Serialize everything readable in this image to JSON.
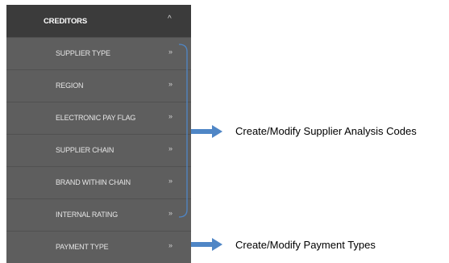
{
  "menu": {
    "header": {
      "label": "CREDITORS",
      "chevron": "^"
    },
    "items": [
      {
        "label": "SUPPLIER TYPE",
        "chevron": "»"
      },
      {
        "label": "REGION",
        "chevron": "»"
      },
      {
        "label": "ELECTRONIC PAY FLAG",
        "chevron": "»"
      },
      {
        "label": "SUPPLIER CHAIN",
        "chevron": "»"
      },
      {
        "label": "BRAND WITHIN CHAIN",
        "chevron": "»"
      },
      {
        "label": "INTERNAL RATING",
        "chevron": "»"
      },
      {
        "label": "PAYMENT TYPE",
        "chevron": "»"
      }
    ]
  },
  "callouts": {
    "analysis_codes": "Create/Modify Supplier Analysis Codes",
    "payment_types": "Create/Modify Payment Types"
  },
  "colors": {
    "menu_header_bg": "#3b3b3b",
    "menu_bg": "#5e5e5e",
    "bracket": "#4f86c6",
    "arrow": "#4f86c6"
  }
}
